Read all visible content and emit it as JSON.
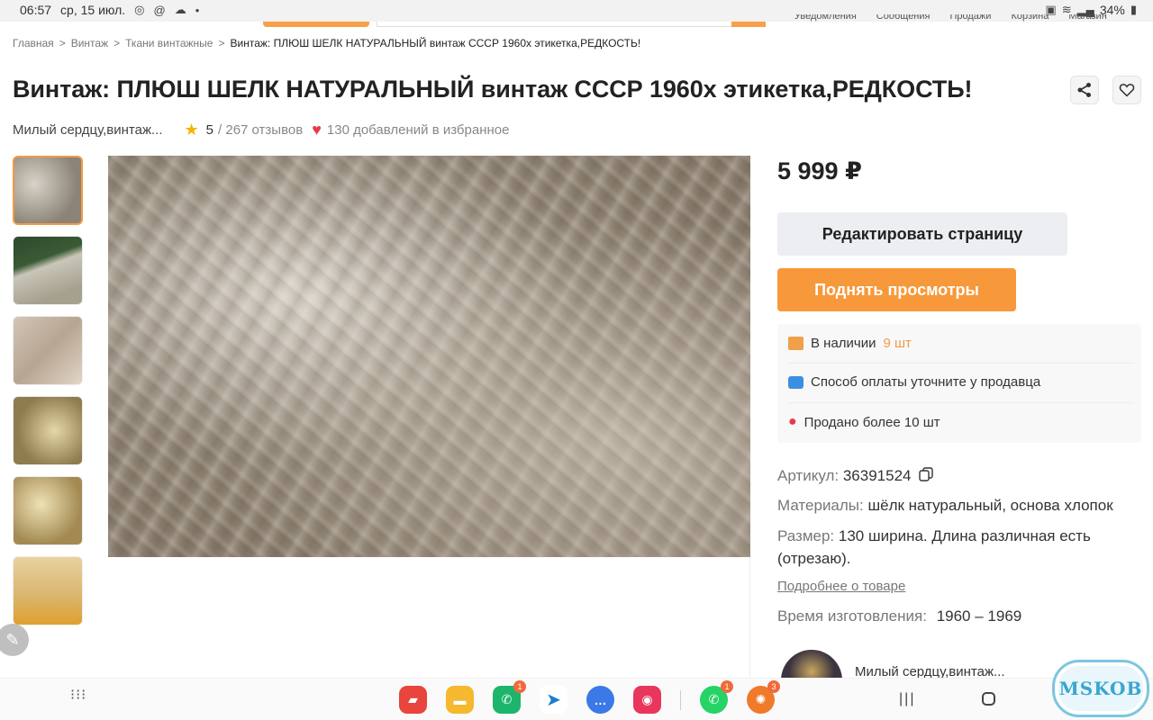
{
  "status_bar": {
    "time": "06:57",
    "date": "ср, 15 июл.",
    "battery": "34%"
  },
  "top_links": [
    "Уведомления",
    "Сообщения",
    "Продажи",
    "Корзина",
    "Магазин"
  ],
  "breadcrumbs": [
    "Главная",
    "Винтаж",
    "Ткани винтажные",
    "Винтаж: ПЛЮШ ШЕЛК НАТУРАЛЬНЫЙ винтаж СССР 1960х этикетка,РЕДКОСТЬ!"
  ],
  "breadcrumb_separator": ">",
  "product": {
    "title": "Винтаж: ПЛЮШ ШЕЛК НАТУРАЛЬНЫЙ винтаж СССР 1960х этикетка,РЕДКОСТЬ!",
    "shop_name": "Милый сердцу,винтаж...",
    "rating": "5",
    "reviews": "/ 267 отзывов",
    "favorites": "130 добавлений в избранное",
    "price": "5 999 ₽"
  },
  "actions": {
    "edit_label": "Редактировать страницу",
    "boost_label": "Поднять просмотры"
  },
  "info": {
    "stock_label": "В наличии",
    "stock_value": "9 шт",
    "payment": "Способ оплаты уточните у продавца",
    "sold": "Продано более 10 шт"
  },
  "specs": {
    "article_label": "Артикул:",
    "article_value": "36391524",
    "materials_label": "Материалы:",
    "materials_value": "шёлк натуральный, основа хлопок",
    "size_label": "Размер:",
    "size_value": "130 ширина. Длина различная есть (отрезаю).",
    "more_link": "Подробнее о товаре",
    "made_label": "Время изготовления:",
    "made_value": "1960 – 1969"
  },
  "seller": {
    "name": "Милый сердцу,винтаж..."
  },
  "dock_badges": {
    "phone": "1",
    "whatsapp": "1",
    "last": "3"
  },
  "watermark": "MSKOB",
  "icons": {
    "share": "share-icon",
    "favorite": "heart-icon",
    "copy": "copy-icon",
    "edit": "pencil-icon"
  }
}
